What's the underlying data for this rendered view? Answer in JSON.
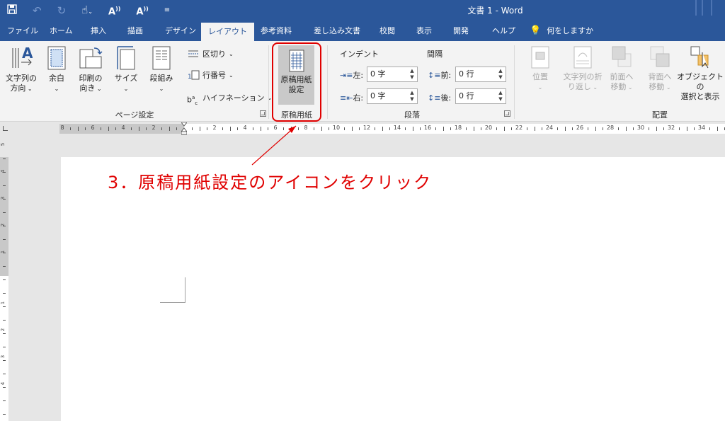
{
  "title_bar": {
    "title": "文書 1  -  Word",
    "qat": [
      "save-icon",
      "undo-icon",
      "redo-icon",
      "touch-mode-icon",
      "read-aloud-icon",
      "read-aloud-icon",
      "customize-qat-icon"
    ],
    "bg_color": "#2b579a"
  },
  "tabs": [
    {
      "label": "ファイル"
    },
    {
      "label": "ホーム"
    },
    {
      "label": "挿入"
    },
    {
      "label": "描画"
    },
    {
      "label": "デザイン"
    },
    {
      "label": "レイアウト",
      "active": true
    },
    {
      "label": "参考資料"
    },
    {
      "label": "差し込み文書"
    },
    {
      "label": "校閲"
    },
    {
      "label": "表示"
    },
    {
      "label": "開発"
    },
    {
      "label": "ヘルプ"
    }
  ],
  "tell_me": "何をしますか",
  "ribbon": {
    "page_setup": {
      "label": "ページ設定",
      "text_direction": "文字列の\n方向",
      "margins": "余白",
      "orientation": "印刷の\n向き",
      "size": "サイズ",
      "columns": "段組み",
      "breaks": "区切り",
      "line_numbers": "行番号",
      "hyphenation": "ハイフネーション"
    },
    "genko": {
      "label": "原稿用紙",
      "setting": "原稿用紙\n設定"
    },
    "paragraph": {
      "label": "段落",
      "indent_title": "インデント",
      "spacing_title": "間隔",
      "left_label": "左:",
      "left_value": "0 字",
      "right_label": "右:",
      "right_value": "0 字",
      "before_label": "前:",
      "before_value": "0 行",
      "after_label": "後:",
      "after_value": "0 行"
    },
    "arrange": {
      "label": "配置",
      "position": "位置",
      "wrap_text": "文字列の折\nり返し",
      "bring_forward": "前面へ\n移動",
      "send_backward": "背面へ\n移動",
      "selection_pane": "オブジェクトの\n選択と表示"
    }
  },
  "ruler": {
    "labels_left": [
      "8",
      "6",
      "4",
      "2"
    ],
    "labels_right": [
      "2",
      "4",
      "6",
      "8",
      "10",
      "12",
      "14",
      "16",
      "18",
      "20",
      "22",
      "24",
      "26",
      "28",
      "30",
      "32",
      "34"
    ]
  },
  "vruler": {
    "labels_top": [
      "5",
      "4",
      "3",
      "2",
      "1"
    ],
    "labels_bottom": [
      "1",
      "2",
      "3",
      "4"
    ]
  },
  "annotation": {
    "text": "3．原稿用紙設定のアイコンをクリック",
    "color": "#e00000"
  }
}
